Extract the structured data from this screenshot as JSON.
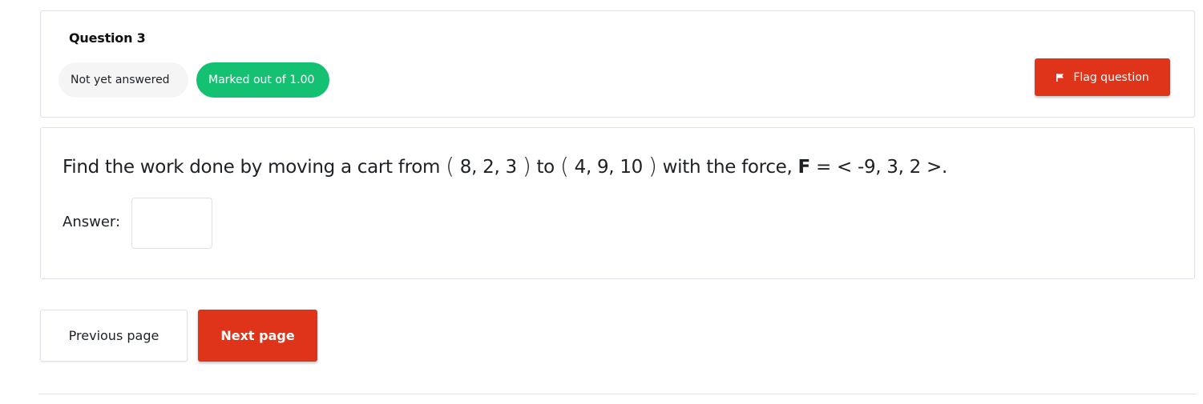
{
  "question_info": {
    "title": "Question 3",
    "state": "Not yet answered",
    "mark": "Marked out of 1.00",
    "flag_label": "Flag question",
    "flag_icon": "flag-icon"
  },
  "question": {
    "text_part1": "Find the work done by moving a cart from ",
    "point1": " 8, 2, 3 ",
    "text_part2": " to ",
    "point2": " 4, 9, 10 ",
    "text_part3": " with the force, ",
    "force_symbol": "F",
    "text_part4": " = < -9, 3, 2 >.",
    "answer_label": "Answer:",
    "answer_value": ""
  },
  "navigation": {
    "prev_label": "Previous page",
    "next_label": "Next page"
  },
  "colors": {
    "accent": "#e0341a",
    "success": "#14c173",
    "state_bg": "#f5f5f5"
  }
}
